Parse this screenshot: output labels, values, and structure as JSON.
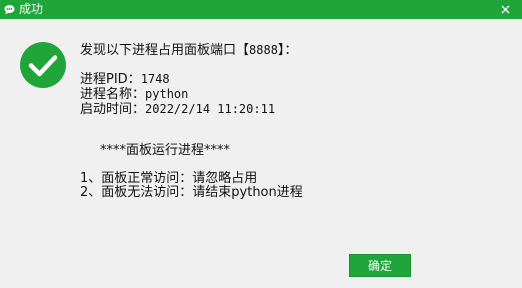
{
  "window": {
    "title": "成功",
    "close_symbol": "✕",
    "title_icon": "chat-bubble-icon",
    "accent_color": "#20a53a"
  },
  "message": {
    "icon": "check-circle-icon",
    "headline_prefix": "发现以下进程占用面板端口【",
    "headline_port": "8888",
    "headline_suffix": "】：",
    "pid_label": "进程PID：",
    "pid_value": "1748",
    "name_label": "进程名称：",
    "name_value": "python",
    "start_label": "启动时间：",
    "start_value": "2022/2/14 11:20:11",
    "section_title": "****面板运行进程****",
    "option1": "1、面板正常访问：请忽略占用",
    "option2": "2、面板无法访问：请结束python进程"
  },
  "buttons": {
    "ok_label": "确定"
  }
}
